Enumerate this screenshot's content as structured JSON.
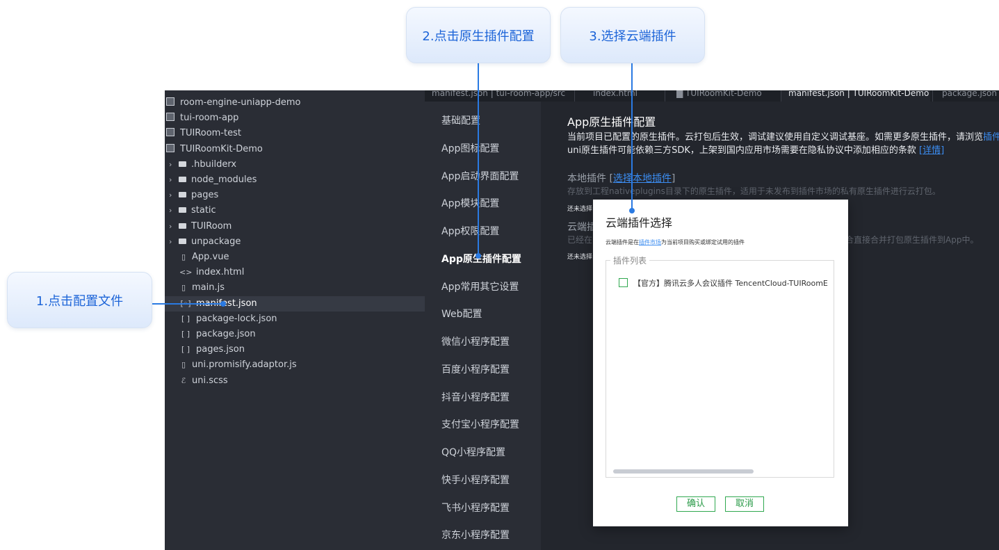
{
  "callouts": {
    "step1": "1.点击配置文件",
    "step2": "2.点击原生插件配置",
    "step3": "3.选择云端插件"
  },
  "explorer": {
    "items": [
      {
        "label": "room-engine-uniapp-demo",
        "kind": "project"
      },
      {
        "label": "tui-room-app",
        "kind": "project"
      },
      {
        "label": "TUIRoom-test",
        "kind": "project"
      },
      {
        "label": "TUIRoomKit-Demo",
        "kind": "project"
      },
      {
        "label": ".hbuilderx",
        "kind": "folder"
      },
      {
        "label": "node_modules",
        "kind": "folder"
      },
      {
        "label": "pages",
        "kind": "folder"
      },
      {
        "label": "static",
        "kind": "folder"
      },
      {
        "label": "TUIRoom",
        "kind": "folder"
      },
      {
        "label": "unpackage",
        "kind": "folder"
      },
      {
        "label": "App.vue",
        "kind": "file",
        "glyph": "▯"
      },
      {
        "label": "index.html",
        "kind": "file",
        "glyph": "<>"
      },
      {
        "label": "main.js",
        "kind": "file",
        "glyph": "▯"
      },
      {
        "label": "manifest.json",
        "kind": "file",
        "glyph": "[◦]"
      },
      {
        "label": "package-lock.json",
        "kind": "file",
        "glyph": "[ ]"
      },
      {
        "label": "package.json",
        "kind": "file",
        "glyph": "[ ]"
      },
      {
        "label": "pages.json",
        "kind": "file",
        "glyph": "[ ]"
      },
      {
        "label": "uni.promisify.adaptor.js",
        "kind": "file",
        "glyph": "▯"
      },
      {
        "label": "uni.scss",
        "kind": "file",
        "glyph": "ℰ"
      }
    ]
  },
  "tabs": [
    {
      "label": "manifest.json | tui-room-app/src"
    },
    {
      "label": "index.html"
    },
    {
      "label": "▇ TUIRoomKit-Demo"
    },
    {
      "label": "manifest.json | TUIRoomKit-Demo"
    },
    {
      "label": "package.json |"
    }
  ],
  "settings_nav": [
    "基础配置",
    "App图标配置",
    "App启动界面配置",
    "App模块配置",
    "App权限配置",
    "App原生插件配置",
    "App常用其它设置",
    "Web配置",
    "微信小程序配置",
    "百度小程序配置",
    "抖音小程序配置",
    "支付宝小程序配置",
    "QQ小程序配置",
    "快手小程序配置",
    "飞书小程序配置",
    "京东小程序配置"
  ],
  "content": {
    "title": "App原生插件配置",
    "desc1": "当前项目已配置的原生插件。云打包后生效，调试建议使用自定义调试基座。如需更多原生插件，请浏览",
    "desc1_link": "插件",
    "desc2": "uni原生插件可能依赖三方SDK，上架到国内应用市场需要在隐私协议中添加相应的条款",
    "desc2_link": "[详情]",
    "local_label": "本地插件",
    "local_link": "选择本地插件",
    "local_bracket_open": "[",
    "local_bracket_close": "]",
    "local_desc": "存放到工程nativeplugins目录下的原生插件，适用于未发布到插件市场的私有原生插件进行云打包。",
    "local_none": "还未选择",
    "cloud_label": "云端插",
    "cloud_desc_left": "已经在",
    "cloud_desc_right": "合直接合并打包原生插件到App中。",
    "cloud_none": "还未选择"
  },
  "modal": {
    "title": "云端插件选择",
    "desc_prefix": "云端插件是在",
    "desc_link": "插件市场",
    "desc_suffix": "为当前项目购买或绑定试用的插件",
    "list_legend": "插件列表",
    "plugin_label": "【官方】腾讯云多人会议插件 TencentCloud-TUIRoomE",
    "confirm": "确认",
    "cancel": "取消"
  },
  "colors": {
    "accent": "#2a7ae2",
    "link": "#3b8cf0",
    "button_green": "#2fa84f"
  }
}
